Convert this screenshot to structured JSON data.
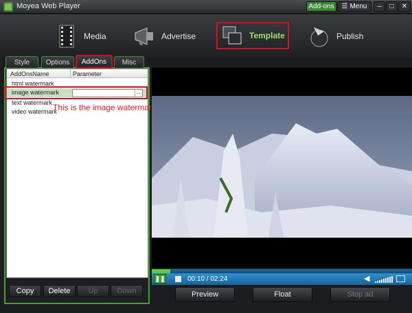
{
  "window": {
    "title": "Moyea Web Player",
    "addons_label": "Add-ons",
    "menu_label": "Menu",
    "min_glyph": "–",
    "max_glyph": "□",
    "close_glyph": "✕"
  },
  "nav": {
    "items": [
      {
        "label": "Media",
        "icon": "film-icon"
      },
      {
        "label": "Advertise",
        "icon": "megaphone-icon"
      },
      {
        "label": "Template",
        "icon": "template-icon"
      },
      {
        "label": "Publish",
        "icon": "publish-icon"
      }
    ]
  },
  "tabs": [
    "Style",
    "Options",
    "AddOns",
    "Misc"
  ],
  "grid": {
    "headers": [
      "AddOnsName",
      "Parameter"
    ],
    "rows": [
      "html watermark",
      "image watermark",
      "text watermark",
      "video watermark"
    ],
    "selected_row": "image watermark",
    "ellipsis": "···"
  },
  "annotation": "This is the image watermark plugin",
  "list_buttons": [
    "Copy",
    "Delete",
    "Up",
    "Down"
  ],
  "player": {
    "time": "00:10 / 02:24",
    "progress": 0.07
  },
  "player_buttons": [
    "Preview",
    "Float",
    "Stop ad"
  ],
  "colors": {
    "accent_green": "#4b9d3a",
    "highlight_red": "#d2131f",
    "player_blue": "#2f90cf"
  }
}
